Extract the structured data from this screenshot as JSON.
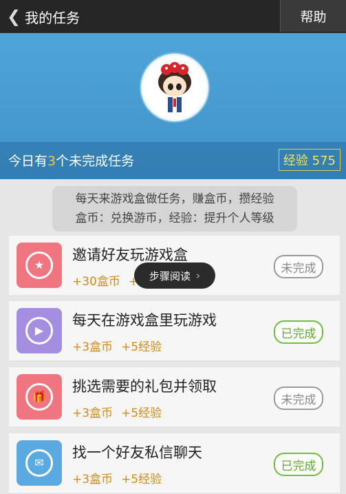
{
  "header": {
    "back_icon": "chevron-left-icon",
    "title": "我的任务",
    "help_label": "帮助"
  },
  "status": {
    "prefix": "今日有",
    "count": "3",
    "suffix": "个未完成任务",
    "exp_label": "经验 575"
  },
  "notice": {
    "line1": "每天来游戏盒做任务，赚盒币，攒经验",
    "line2": "盒币：兑换游币，经验：提升个人等级"
  },
  "tasks": [
    {
      "name": "邀请好友玩游戏盒",
      "coins": "+30盒币",
      "exp": "+",
      "status": "未完成",
      "icon": "hand-star-icon",
      "color": "#ef7680"
    },
    {
      "name": "每天在游戏盒里玩游戏",
      "coins": "+3盒币",
      "exp": "+5经验",
      "status": "已完成",
      "icon": "play-icon",
      "color": "#a48ee0"
    },
    {
      "name": "挑选需要的礼包并领取",
      "coins": "+3盒币",
      "exp": "+5经验",
      "status": "未完成",
      "icon": "gift-icon",
      "color": "#ef7680"
    },
    {
      "name": "找一个好友私信聊天",
      "coins": "+3盒币",
      "exp": "+5经验",
      "status": "已完成",
      "icon": "mail-icon",
      "color": "#5aa9e0"
    }
  ],
  "tooltip": {
    "label": "步骤阅读",
    "arrow": "›"
  }
}
